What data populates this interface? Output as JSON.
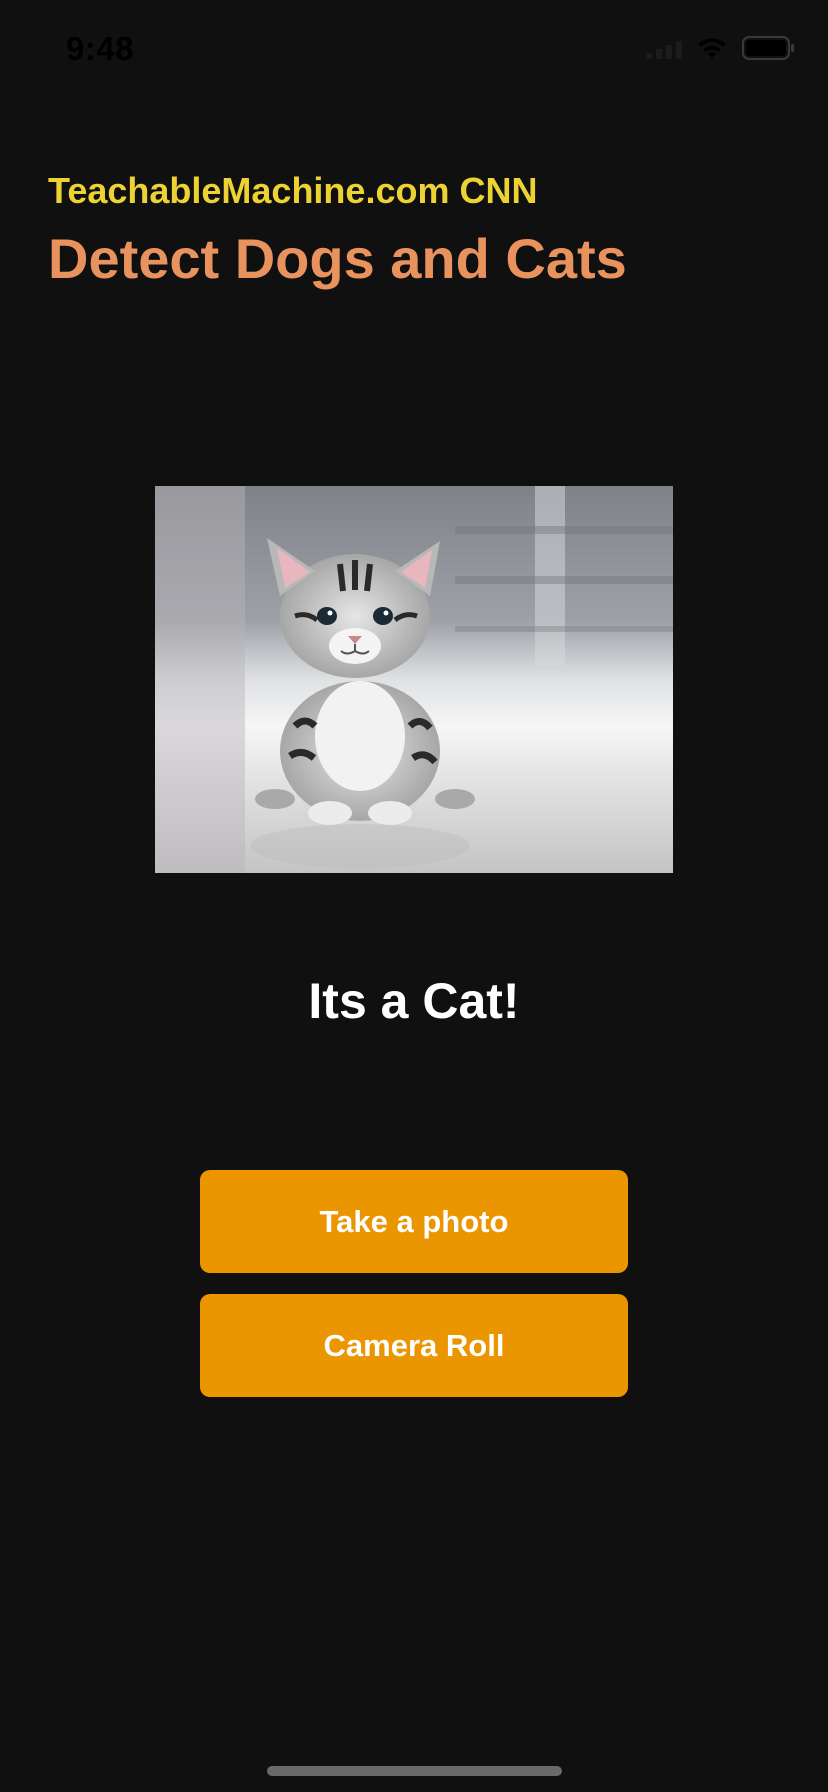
{
  "status_bar": {
    "time": "9:48"
  },
  "header": {
    "subtitle": "TeachableMachine.com CNN",
    "title": "Detect Dogs and Cats"
  },
  "main": {
    "image_subject": "kitten",
    "result": "Its a Cat!"
  },
  "buttons": {
    "take_photo": "Take a photo",
    "camera_roll": "Camera Roll"
  },
  "colors": {
    "background": "#101010",
    "subtitle": "#ecd333",
    "title": "#e8925e",
    "button": "#eb9500"
  }
}
